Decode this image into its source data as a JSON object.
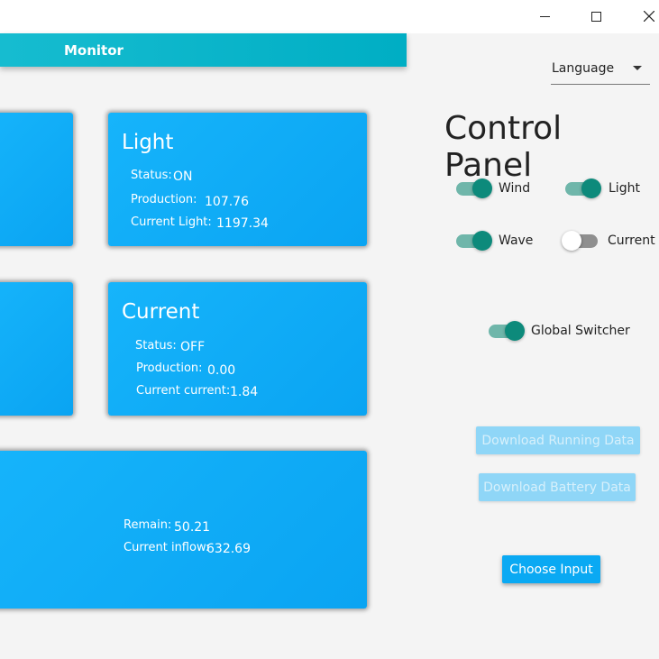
{
  "window": {
    "min_icon": "minimize-icon",
    "max_icon": "maximize-icon",
    "close_icon": "close-icon"
  },
  "header": {
    "title": "Monitor"
  },
  "cards": {
    "light": {
      "title": "Light",
      "status_label": "Status:",
      "status_value": "ON",
      "production_label": "Production:",
      "production_value": "107.76",
      "extra_label": "Current Light:",
      "extra_value": "1197.34"
    },
    "current": {
      "title": "Current",
      "status_label": "Status:",
      "status_value": "OFF",
      "production_label": "Production:",
      "production_value": "0.00",
      "extra_label": "Current current:",
      "extra_value": "1.84"
    },
    "battery": {
      "remain_label": "Remain:",
      "remain_value": "50.21",
      "inflow_label": "Current inflow:",
      "inflow_value": "632.69"
    }
  },
  "control_panel": {
    "language": {
      "label": "Language",
      "icon": "dropdown-arrow-icon"
    },
    "title": "Control Panel",
    "toggles": {
      "wind": {
        "label": "Wind",
        "on": true
      },
      "light": {
        "label": "Light",
        "on": true
      },
      "wave": {
        "label": "Wave",
        "on": true
      },
      "current": {
        "label": "Current",
        "on": false
      },
      "global": {
        "label": "Global Switcher",
        "on": true
      }
    },
    "buttons": {
      "download_running": "Download Running Data",
      "download_battery": "Download Battery Data",
      "choose_input": "Choose Input"
    }
  },
  "colors": {
    "accent": "#0aa9f3",
    "header": "#00aec4",
    "toggle_on": "#0d8a7b"
  }
}
